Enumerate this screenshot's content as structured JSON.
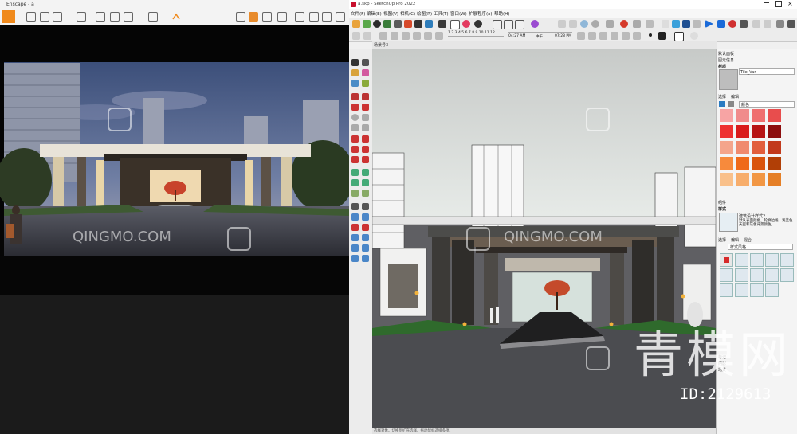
{
  "enscape": {
    "title": "Enscape - a",
    "logo_color": "#f08a1c"
  },
  "sketchup": {
    "title": "a.skp - SketchUp Pro 2022",
    "menus": [
      "文件(F)",
      "编辑(E)",
      "视图(V)",
      "相机(C)",
      "绘图(R)",
      "工具(T)",
      "窗口(W)",
      "扩展程序(x)",
      "帮助(H)"
    ],
    "toolbar_numbers": [
      "1",
      "2",
      "3",
      "4",
      "5",
      "6",
      "7",
      "8",
      "9",
      "10",
      "11",
      "12"
    ],
    "time_start": "04:27 AM",
    "time_mid": "中午",
    "time_end": "07:28 PM",
    "scene_tab": "场景号3",
    "status_text": "选择对象。切换到扩充选择。拖动鼠标选择多项。"
  },
  "tray": {
    "default_panel": "默认面板",
    "scene_info": "图元信息",
    "materials": "材质",
    "material_name": "Tile_Var",
    "select_label": "选择",
    "edit_label": "编辑",
    "color_dropdown": "颜色",
    "components": "组件",
    "styles": "样式",
    "style_name": "建筑设计样式2",
    "style_desc": "默认表面颜色，轮廓边线，浅蓝色天空和灰色背景颜色。",
    "style_tab_select": "选择",
    "style_tab_edit": "编辑",
    "style_tab_mix": "混合",
    "style_dropdown": "样式风格",
    "tags": "标记",
    "shadows": "阴影",
    "scenes": "场景",
    "swatch_colors": [
      "#f7a4a4",
      "#f08b8b",
      "#ef6f6f",
      "#e84d4d",
      "#ee3030",
      "#d91b1b",
      "#b71414",
      "#8c0d0d",
      "#f4a58b",
      "#f08a6e",
      "#e25e3c",
      "#c23a1c",
      "#f78a3c",
      "#ef6a1a",
      "#d9540d",
      "#b13f06",
      "#f9c08a",
      "#f7ad6b",
      "#f29744",
      "#e57f26"
    ]
  },
  "watermark": {
    "brand": "QINGMO.COM",
    "big_text": "青模网",
    "id_text": "ID:2129613"
  }
}
